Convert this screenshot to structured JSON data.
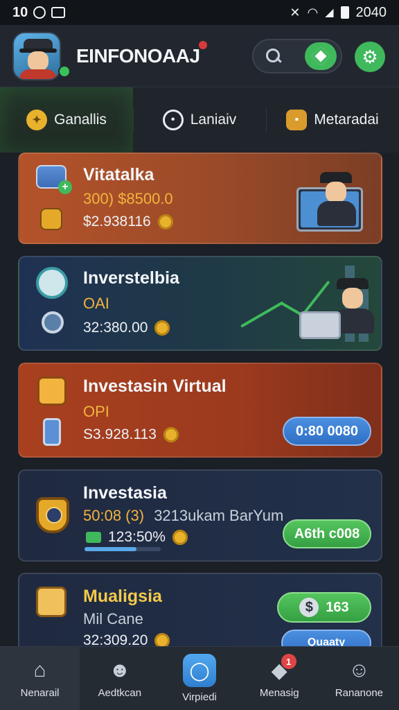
{
  "status_bar": {
    "left_text": "10",
    "time": "2040"
  },
  "header": {
    "app_title": "EINFONOAAJ",
    "search_icon": "search-icon",
    "gem_icon": "gem-icon",
    "settings_icon": "gear-icon"
  },
  "tabs": [
    {
      "label": "Ganallis",
      "icon": "coin-badge-icon"
    },
    {
      "label": "Laniaiv",
      "icon": "chat-bubble-icon"
    },
    {
      "label": "Metaradai",
      "icon": "bag-icon"
    }
  ],
  "cards": [
    {
      "title": "Vitatalka",
      "subtitle": "300) $8500.0",
      "value": "$2.938116",
      "icon": "card-add-icon",
      "secondary_icon": "folder-icon"
    },
    {
      "title": "Inverstelbia",
      "subtitle": "OAI",
      "value": "32:380.00",
      "icon": "badge-icon",
      "secondary_icon": "magnify-icon"
    },
    {
      "title": "Investasin Virtual",
      "subtitle": "OPI",
      "value": "S3.928.113",
      "icon": "pencil-icon",
      "secondary_icon": "phone-icon",
      "button": "0:80 0080"
    },
    {
      "title": "Investasia",
      "subtitle": "50:08 (3)",
      "subtitle_extra": "3213ukam BarYum",
      "value": "123:50%",
      "icon": "shield-compass-icon",
      "button": "A6th c008",
      "progress": 0.68
    },
    {
      "title": "Mualigsia",
      "subtitle": "Mil Cane",
      "value": "32:309.20",
      "icon": "box-icon",
      "button_top": "163",
      "button_bottom": "Quaaty"
    }
  ],
  "bottom_nav": [
    {
      "label": "Nenarail",
      "icon": "home-icon"
    },
    {
      "label": "Aedtkcan",
      "icon": "users-icon"
    },
    {
      "label": "Virpiedi",
      "icon": "chat-icon"
    },
    {
      "label": "Menasig",
      "icon": "inbox-icon",
      "badge": "1"
    },
    {
      "label": "Rananone",
      "icon": "profile-icon"
    }
  ]
}
